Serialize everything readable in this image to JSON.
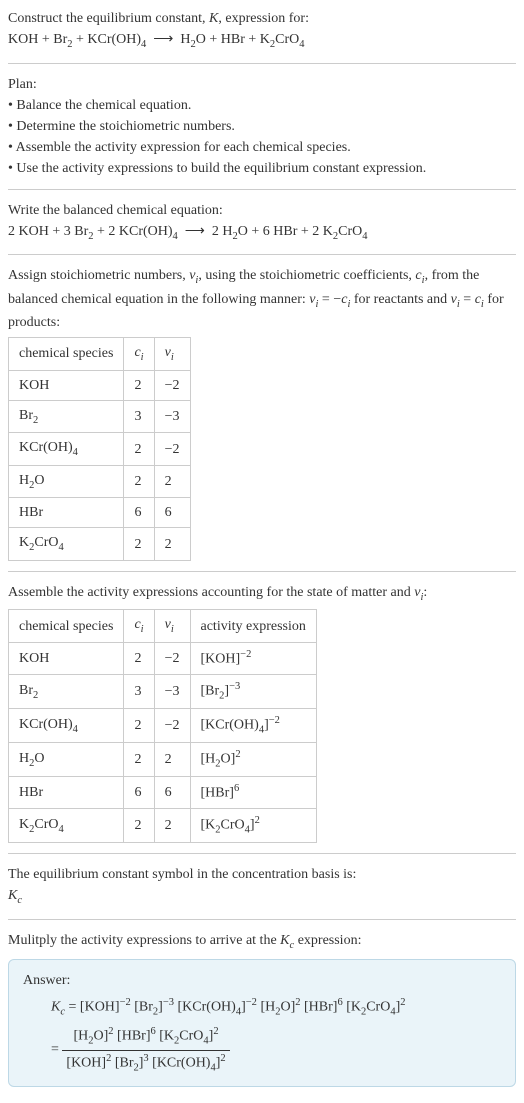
{
  "section1": {
    "title_a": "Construct the equilibrium constant, ",
    "title_b": ", expression for:",
    "eq_lhs": "KOH + Br",
    "eq_sub1": "2",
    "eq_mid1": " + KCr(OH)",
    "eq_sub2": "4",
    "arrow": "⟶",
    "eq_rhs1": "H",
    "eq_rhs1s": "2",
    "eq_rhs2": "O + HBr + K",
    "eq_rhs2s": "2",
    "eq_rhs3": "CrO",
    "eq_rhs3s": "4"
  },
  "plan": {
    "heading": "Plan:",
    "b1": "• Balance the chemical equation.",
    "b2": "• Determine the stoichiometric numbers.",
    "b3": "• Assemble the activity expression for each chemical species.",
    "b4": "• Use the activity expressions to build the equilibrium constant expression."
  },
  "balanced": {
    "heading": "Write the balanced chemical equation:",
    "l1": "2 KOH + 3 Br",
    "l1s": "2",
    "l2": " + 2 KCr(OH)",
    "l2s": "4",
    "arrow": "⟶",
    "r1": "2 H",
    "r1s": "2",
    "r2": "O + 6 HBr + 2 K",
    "r2s": "2",
    "r3": "CrO",
    "r3s": "4"
  },
  "assign": {
    "t1": "Assign stoichiometric numbers, ",
    "nu": "ν",
    "i": "i",
    "t2": ", using the stoichiometric coefficients, ",
    "c": "c",
    "t3": ", from the balanced chemical equation in the following manner: ",
    "t_eq1a": " = −",
    "t_eq1b": " for reactants and ",
    "t_eq2a": " = ",
    "t_eq2b": " for products:"
  },
  "table1": {
    "h1": "chemical species",
    "h2": "c",
    "h3": "ν",
    "rows": [
      {
        "sp_a": "KOH",
        "sp_b": "",
        "sp_c": "",
        "c": "2",
        "v": "−2"
      },
      {
        "sp_a": "Br",
        "sp_b": "2",
        "sp_c": "",
        "c": "3",
        "v": "−3"
      },
      {
        "sp_a": "KCr(OH)",
        "sp_b": "4",
        "sp_c": "",
        "c": "2",
        "v": "−2"
      },
      {
        "sp_a": "H",
        "sp_b": "2",
        "sp_c": "O",
        "c": "2",
        "v": "2"
      },
      {
        "sp_a": "HBr",
        "sp_b": "",
        "sp_c": "",
        "c": "6",
        "v": "6"
      },
      {
        "sp_a": "K",
        "sp_b": "2",
        "sp_c": "CrO",
        "sp_d": "4",
        "c": "2",
        "v": "2"
      }
    ]
  },
  "assemble": {
    "t1": "Assemble the activity expressions accounting for the state of matter and ",
    "t2": ":"
  },
  "table2": {
    "h1": "chemical species",
    "h2": "c",
    "h3": "ν",
    "h4": "activity expression",
    "rows": [
      {
        "sp_a": "KOH",
        "sp_b": "",
        "sp_c": "",
        "sp_d": "",
        "c": "2",
        "v": "−2",
        "ae_a": "[KOH]",
        "ae_e": "−2"
      },
      {
        "sp_a": "Br",
        "sp_b": "2",
        "sp_c": "",
        "sp_d": "",
        "c": "3",
        "v": "−3",
        "ae_a": "[Br",
        "ae_b": "2",
        "ae_c": "]",
        "ae_e": "−3"
      },
      {
        "sp_a": "KCr(OH)",
        "sp_b": "4",
        "sp_c": "",
        "sp_d": "",
        "c": "2",
        "v": "−2",
        "ae_a": "[KCr(OH)",
        "ae_b": "4",
        "ae_c": "]",
        "ae_e": "−2"
      },
      {
        "sp_a": "H",
        "sp_b": "2",
        "sp_c": "O",
        "sp_d": "",
        "c": "2",
        "v": "2",
        "ae_a": "[H",
        "ae_b": "2",
        "ae_c": "O]",
        "ae_e": "2"
      },
      {
        "sp_a": "HBr",
        "sp_b": "",
        "sp_c": "",
        "sp_d": "",
        "c": "6",
        "v": "6",
        "ae_a": "[HBr]",
        "ae_e": "6"
      },
      {
        "sp_a": "K",
        "sp_b": "2",
        "sp_c": "CrO",
        "sp_d": "4",
        "c": "2",
        "v": "2",
        "ae_a": "[K",
        "ae_b": "2",
        "ae_c": "CrO",
        "ae_d": "4",
        "ae_f": "]",
        "ae_e": "2"
      }
    ]
  },
  "kc_symbol": {
    "t": "The equilibrium constant symbol in the concentration basis is:",
    "k": "K",
    "c": "c"
  },
  "multiply": {
    "t1": "Mulitply the activity expressions to arrive at the ",
    "t2": " expression:"
  },
  "answer": {
    "label": "Answer:",
    "k": "K",
    "c": "c",
    "eq": " = ",
    "t1": "[KOH]",
    "e1": "−2",
    "t2a": "[Br",
    "t2b": "2",
    "t2c": "]",
    "e2": "−3",
    "t3a": "[KCr(OH)",
    "t3b": "4",
    "t3c": "]",
    "e3": "−2",
    "t4a": "[H",
    "t4b": "2",
    "t4c": "O]",
    "e4": "2",
    "t5": "[HBr]",
    "e5": "6",
    "t6a": "[K",
    "t6b": "2",
    "t6c": "CrO",
    "t6d": "4",
    "t6e": "]",
    "e6": "2",
    "eq2": "= ",
    "num1a": "[H",
    "num1b": "2",
    "num1c": "O]",
    "ne1": "2",
    "num2": "[HBr]",
    "ne2": "6",
    "num3a": "[K",
    "num3b": "2",
    "num3c": "CrO",
    "num3d": "4",
    "num3e": "]",
    "ne3": "2",
    "den1": "[KOH]",
    "de1": "2",
    "den2a": "[Br",
    "den2b": "2",
    "den2c": "]",
    "de2": "3",
    "den3a": "[KCr(OH)",
    "den3b": "4",
    "den3c": "]",
    "de3": "2"
  },
  "chart_data": {
    "type": "table",
    "tables": [
      {
        "columns": [
          "chemical species",
          "c_i",
          "ν_i"
        ],
        "rows": [
          [
            "KOH",
            2,
            -2
          ],
          [
            "Br2",
            3,
            -3
          ],
          [
            "KCr(OH)4",
            2,
            -2
          ],
          [
            "H2O",
            2,
            2
          ],
          [
            "HBr",
            6,
            6
          ],
          [
            "K2CrO4",
            2,
            2
          ]
        ]
      },
      {
        "columns": [
          "chemical species",
          "c_i",
          "ν_i",
          "activity expression"
        ],
        "rows": [
          [
            "KOH",
            2,
            -2,
            "[KOH]^-2"
          ],
          [
            "Br2",
            3,
            -3,
            "[Br2]^-3"
          ],
          [
            "KCr(OH)4",
            2,
            -2,
            "[KCr(OH)4]^-2"
          ],
          [
            "H2O",
            2,
            2,
            "[H2O]^2"
          ],
          [
            "HBr",
            6,
            6,
            "[HBr]^6"
          ],
          [
            "K2CrO4",
            2,
            2,
            "[K2CrO4]^2"
          ]
        ]
      }
    ]
  }
}
